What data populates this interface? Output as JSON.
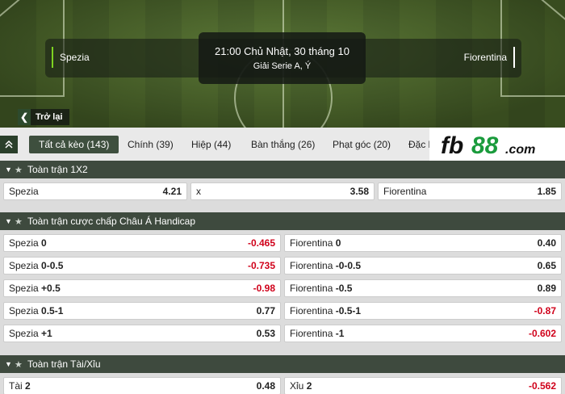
{
  "match": {
    "home": "Spezia",
    "away": "Fiorentina",
    "time": "21:00 Chủ Nhật, 30 tháng 10",
    "league": "Giải Serie A, Ý"
  },
  "back_label": "Trở lại",
  "tabs": [
    {
      "label": "Tất cả kèo (143)",
      "active": true
    },
    {
      "label": "Chính (39)"
    },
    {
      "label": "Hiệp (44)"
    },
    {
      "label": "Bàn thắng (26)"
    },
    {
      "label": "Phạt góc (20)"
    },
    {
      "label": "Đặc b"
    }
  ],
  "brand": {
    "name": "fb88",
    "suffix": ".com",
    "color_green": "#1a9b3c",
    "color_dark": "#111111"
  },
  "sections": {
    "x12": {
      "title": "Toàn trận 1X2",
      "cells": [
        {
          "name": "Spezia",
          "odd": "4.21"
        },
        {
          "name": "x",
          "odd": "3.58"
        },
        {
          "name": "Fiorentina",
          "odd": "1.85"
        }
      ]
    },
    "handicap": {
      "title": "Toàn trận cược chấp Châu Á Handicap",
      "rows": [
        {
          "home": {
            "team": "Spezia",
            "line": "0",
            "odd": "-0.465"
          },
          "away": {
            "team": "Fiorentina",
            "line": "0",
            "odd": "0.40"
          }
        },
        {
          "home": {
            "team": "Spezia",
            "line": "0-0.5",
            "odd": "-0.735"
          },
          "away": {
            "team": "Fiorentina",
            "line": "-0-0.5",
            "odd": "0.65"
          }
        },
        {
          "home": {
            "team": "Spezia",
            "line": "+0.5",
            "odd": "-0.98"
          },
          "away": {
            "team": "Fiorentina",
            "line": "-0.5",
            "odd": "0.89"
          }
        },
        {
          "home": {
            "team": "Spezia",
            "line": "0.5-1",
            "odd": "0.77"
          },
          "away": {
            "team": "Fiorentina",
            "line": "-0.5-1",
            "odd": "-0.87"
          }
        },
        {
          "home": {
            "team": "Spezia",
            "line": "+1",
            "odd": "0.53"
          },
          "away": {
            "team": "Fiorentina",
            "line": "-1",
            "odd": "-0.602"
          }
        }
      ]
    },
    "totals": {
      "title": "Toàn trận Tài/Xỉu",
      "rows": [
        {
          "over": {
            "label": "Tài",
            "line": "2",
            "odd": "0.48"
          },
          "under": {
            "label": "Xỉu",
            "line": "2",
            "odd": "-0.562"
          }
        }
      ]
    }
  },
  "colors": {
    "accent": "#7ed321",
    "header_bg": "#3e4a3e",
    "negative": "#d0021b"
  }
}
